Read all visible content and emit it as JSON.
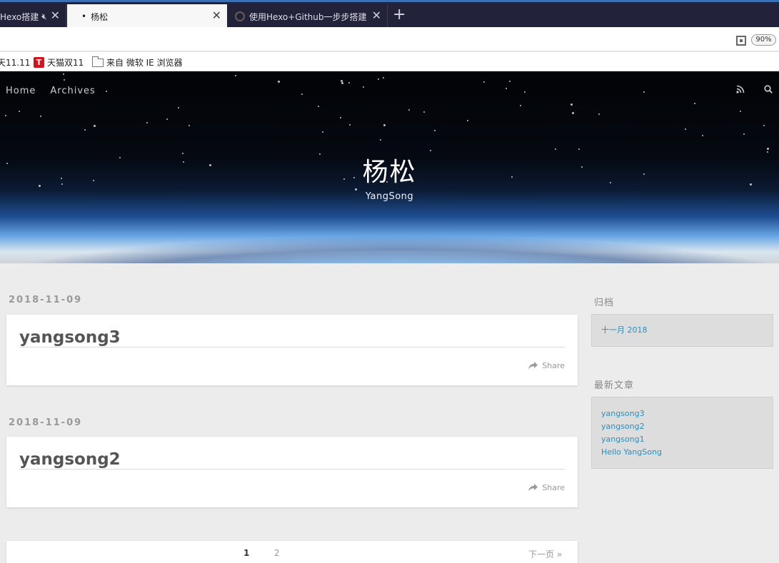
{
  "browser": {
    "tabs": [
      {
        "label": "Hexo搭建",
        "active": false
      },
      {
        "label": "杨松",
        "active": true
      },
      {
        "label": "使用Hexo+Github一步步搭建",
        "active": false
      }
    ],
    "new_tab_glyph": "+",
    "close_glyph": "✕",
    "zoom": "90%",
    "bookmarks": [
      "天11.11",
      "天猫双11",
      "来自 微软 IE 浏览器"
    ]
  },
  "site": {
    "nav": [
      "Home",
      "Archives"
    ],
    "title": "杨松",
    "subtitle": "YangSong",
    "icons": [
      "rss-icon",
      "search-icon"
    ]
  },
  "posts": [
    {
      "date": "2018-11-09",
      "title": "yangsong3",
      "share": "Share"
    },
    {
      "date": "2018-11-09",
      "title": "yangsong2",
      "share": "Share"
    }
  ],
  "pagination": {
    "pages": [
      "1",
      "2"
    ],
    "current": "1",
    "next": "下一页 »"
  },
  "sidebar": {
    "archive": {
      "title": "归档",
      "items": [
        "十一月 2018"
      ]
    },
    "recent": {
      "title": "最新文章",
      "items": [
        "yangsong3",
        "yangsong2",
        "yangsong1",
        "Hello YangSong"
      ]
    }
  },
  "colors": {
    "accent": "#2a8fbd",
    "tabbar": "#22233a",
    "page_bg": "#ececec"
  }
}
